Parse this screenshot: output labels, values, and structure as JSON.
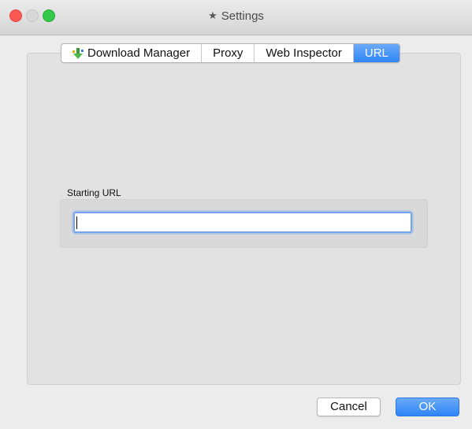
{
  "window": {
    "title": "Settings",
    "title_icon": "star-icon"
  },
  "tabs": [
    {
      "label": "Download Manager",
      "icon": "download-arrow-icon",
      "active": false
    },
    {
      "label": "Proxy",
      "active": false
    },
    {
      "label": "Web Inspector",
      "active": false
    },
    {
      "label": "URL",
      "active": true
    }
  ],
  "url_section": {
    "label": "Starting URL",
    "value": "",
    "placeholder": ""
  },
  "buttons": {
    "cancel": "Cancel",
    "ok": "OK"
  },
  "colors": {
    "accent": "#2f86f6",
    "close": "#fc5753",
    "zoom": "#34c84a"
  }
}
